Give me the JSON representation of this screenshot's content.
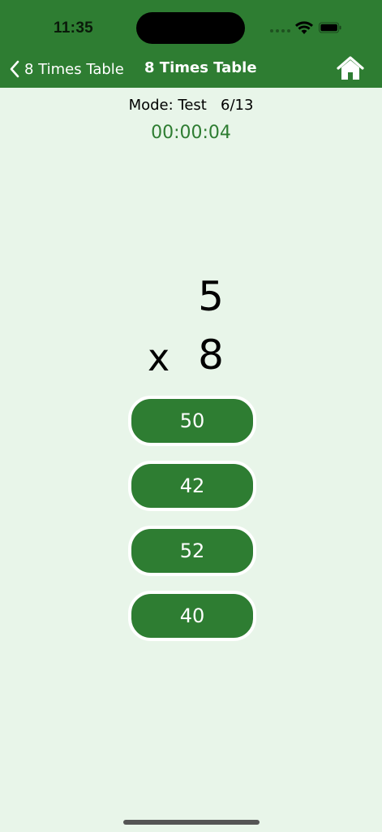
{
  "status_bar": {
    "time": "11:35"
  },
  "nav": {
    "back_label": "8 Times Table",
    "title": "8 Times Table",
    "back_icon": "chevron-left-icon",
    "home_icon": "home-icon"
  },
  "quiz": {
    "mode_line": "Mode: Test   6/13",
    "timer": "00:00:04",
    "operand_top": "5",
    "operator": "x",
    "operand_bottom": "8",
    "answers": [
      "50",
      "42",
      "52",
      "40"
    ]
  },
  "colors": {
    "primary": "#2e7d32",
    "background": "#e8f5e9",
    "button_border": "#ffffff"
  }
}
